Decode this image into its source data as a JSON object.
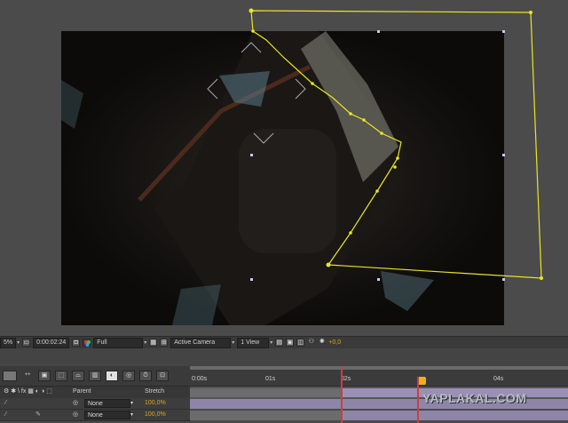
{
  "viewer_toolbar": {
    "zoom": "5%",
    "timecode": "0:00:02:24",
    "resolution": "Full",
    "camera": "Active Camera",
    "views": "1 View",
    "exposure": "+0,0"
  },
  "timeline": {
    "headers": {
      "parent": "Parent",
      "stretch": "Stretch"
    },
    "rows": [
      {
        "parent": "None",
        "stretch": "100,0%"
      },
      {
        "parent": "None",
        "stretch": "100,0%"
      }
    ],
    "ruler": {
      "ticks": [
        "0:00s",
        "01s",
        "02s",
        "04s"
      ]
    }
  },
  "watermark": "YAPLAKAL.COM",
  "colors": {
    "mask_path": "#e9e623",
    "playhead": "#d23b3b",
    "timecode_accent": "#d9a521"
  },
  "icons": [
    "camera-icon",
    "color-channels-icon",
    "grid-icon",
    "region-icon",
    "stopwatch-icon",
    "search-icon",
    "draft-3d-icon",
    "motion-blur-icon"
  ]
}
